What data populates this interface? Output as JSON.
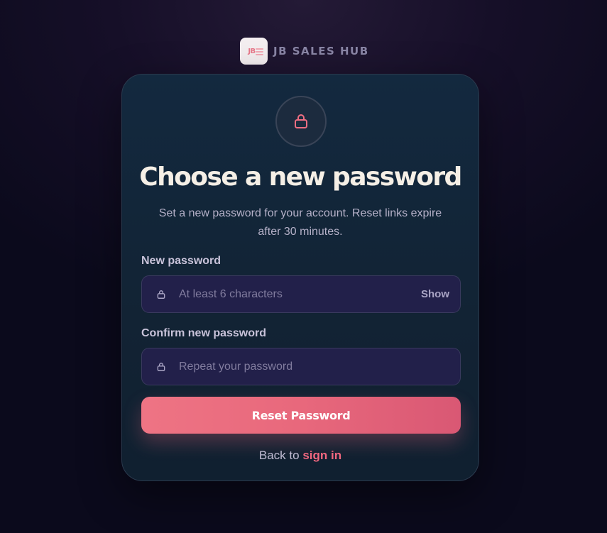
{
  "brand": {
    "logo_text": "JB",
    "name": "JB SALES HUB"
  },
  "card": {
    "icon": "lock-icon",
    "title": "Choose a new password",
    "subtitle": "Set a new password for your account. Reset links expire after 30 minutes."
  },
  "form": {
    "new_password": {
      "label": "New password",
      "placeholder": "At least 6 characters",
      "value": "",
      "icon": "lock-icon",
      "toggle_label": "Show"
    },
    "confirm_password": {
      "label": "Confirm new password",
      "placeholder": "Repeat your password",
      "value": "",
      "icon": "lock-icon"
    },
    "submit_label": "Reset Password"
  },
  "footer": {
    "prefix": "Back to",
    "link_label": "sign in"
  },
  "colors": {
    "accent": "#e8687c",
    "link": "#f0677f",
    "card_bg": "#13293f",
    "input_bg": "#22204a"
  }
}
